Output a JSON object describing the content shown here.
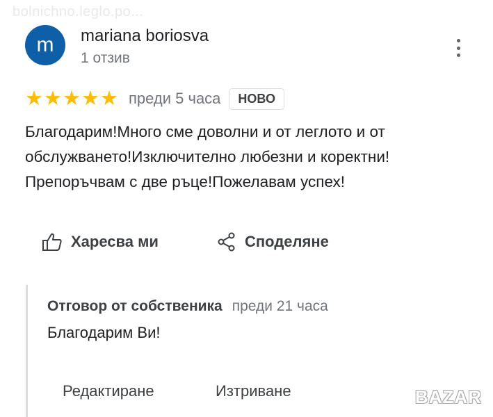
{
  "watermark": {
    "text": "bolnichno.leglo.po..."
  },
  "user": {
    "initial": "m",
    "name": "mariana boriosva",
    "reviews": "1 отзив"
  },
  "review": {
    "stars": [
      "★",
      "★",
      "★",
      "★",
      "★"
    ],
    "rating": 5,
    "time": "преди 5 часа",
    "badge": "НОВО",
    "text": "Благодарим!Много сме доволни и от леглото и от обслужването!Изключително любезни и коректни! Препоръчвам с две ръце!Пожелавам успех!"
  },
  "actions": {
    "like": "Харесва ми",
    "share": "Споделяне"
  },
  "reply": {
    "owner": "Отговор от собственика",
    "time": "преди 21 часа",
    "text": "Благодарим Ви!"
  },
  "reply_actions": {
    "edit": "Редактиране",
    "delete": "Изтриване"
  },
  "logo": {
    "text": "BAZAR"
  },
  "colors": {
    "avatar": "#0f5ea8",
    "star": "#fbbc04",
    "secondary_text": "#70757a"
  }
}
